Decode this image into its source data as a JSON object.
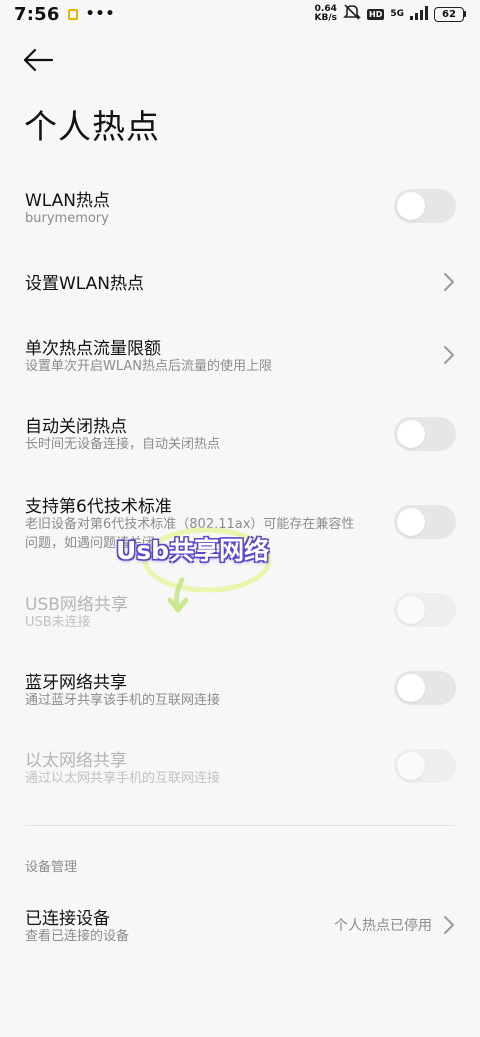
{
  "status_bar": {
    "time": "7:56",
    "more": "•••",
    "net_speed_value": "0.64",
    "net_speed_unit": "KB/s",
    "hd": "HD",
    "signal": "5G",
    "battery": "62"
  },
  "header": {
    "back_icon": "arrow-left-icon",
    "title": "个人热点"
  },
  "settings": [
    {
      "title": "WLAN热点",
      "subtitle": "burymemory",
      "control": "toggle",
      "on": false,
      "enabled": true
    },
    {
      "title": "设置WLAN热点",
      "control": "chevron",
      "enabled": true
    },
    {
      "title": "单次热点流量限额",
      "subtitle": "设置单次开启WLAN热点后流量的使用上限",
      "control": "chevron",
      "enabled": true
    },
    {
      "title": "自动关闭热点",
      "subtitle": "长时间无设备连接，自动关闭热点",
      "control": "toggle",
      "on": false,
      "enabled": true
    },
    {
      "title": "支持第6代技术标准",
      "subtitle_line1": "老旧设备对第6代技术标准（802.11ax）可能存在兼容性",
      "subtitle_line2": "问题，如遇问题请关闭",
      "control": "toggle",
      "on": false,
      "enabled": true
    },
    {
      "title": "USB网络共享",
      "subtitle": "USB未连接",
      "control": "toggle",
      "on": false,
      "enabled": false
    },
    {
      "title": "蓝牙网络共享",
      "subtitle": "通过蓝牙共享该手机的互联网连接",
      "control": "toggle",
      "on": false,
      "enabled": true
    },
    {
      "title": "以太网络共享",
      "subtitle": "通过以太网共享手机的互联网连接",
      "control": "toggle",
      "on": false,
      "enabled": false
    }
  ],
  "device_section": {
    "header": "设备管理",
    "connected_title": "已连接设备",
    "connected_subtitle": "查看已连接的设备",
    "connected_value": "个人热点已停用"
  },
  "watermark": {
    "text": "Usb共享网络",
    "outline_color": "#5a49c8",
    "swirl_color": "#e8f5a0"
  },
  "colors": {
    "background": "#f7f7f7",
    "toggle_off": "#e6e6e6",
    "subtitle": "#8c8c8c"
  }
}
